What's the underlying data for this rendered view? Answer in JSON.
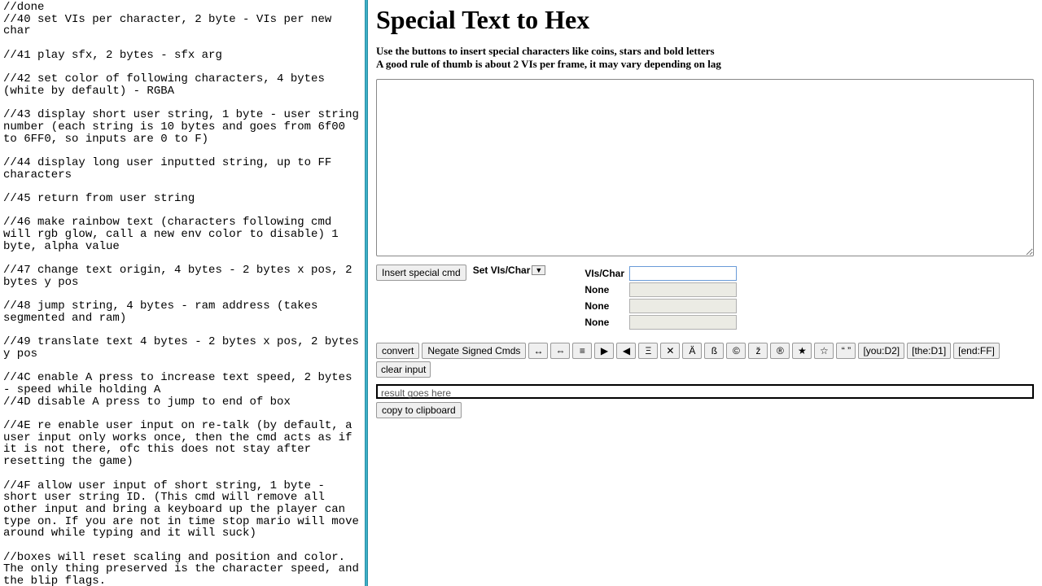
{
  "left": {
    "text": "//done\n//40 set VIs per character, 2 byte - VIs per new char\n\n//41 play sfx, 2 bytes - sfx arg\n\n//42 set color of following characters, 4 bytes (white by default) - RGBA\n\n//43 display short user string, 1 byte - user string number (each string is 10 bytes and goes from 6f00 to 6FF0, so inputs are 0 to F)\n\n//44 display long user inputted string, up to FF characters\n\n//45 return from user string\n\n//46 make rainbow text (characters following cmd will rgb glow, call a new env color to disable) 1 byte, alpha value\n\n//47 change text origin, 4 bytes - 2 bytes x pos, 2 bytes y pos\n\n//48 jump string, 4 bytes - ram address (takes segmented and ram)\n\n//49 translate text 4 bytes - 2 bytes x pos, 2 bytes y pos\n\n//4C enable A press to increase text speed, 2 bytes - speed while holding A\n//4D disable A press to jump to end of box\n\n//4E re enable user input on re-talk (by default, a user input only works once, then the cmd acts as if it is not there, ofc this does not stay after resetting the game)\n\n//4F allow user input of short string, 1 byte - short user string ID. (This cmd will remove all other input and bring a keyboard up the player can type on. If you are not in time stop mario will move around while typing and it will suck)\n\n//boxes will reset scaling and position and color. The only thing preserved is the character speed, and the blip flags."
  },
  "right": {
    "title": "Special Text to Hex",
    "subtitle1": "Use the buttons to insert special characters like coins, stars and bold letters",
    "subtitle2": "A good rule of thumb is about 2 VIs per frame, it may vary depending on lag",
    "insert_cmd": "Insert special cmd",
    "set_vis_label": "Set VIs/Char",
    "dropdown_caret": "▼",
    "vis_table": {
      "row1_label": "VIs/Char",
      "row2_label": "None",
      "row3_label": "None",
      "row4_label": "None"
    },
    "buttons": {
      "convert": "convert",
      "negate": "Negate Signed Cmds",
      "b1": "↔",
      "b2": "⇔",
      "b3": "≡",
      "b4": "▶",
      "b5": "◀",
      "b6": "Ξ",
      "b7": "✕",
      "b8": "Ä",
      "b9": "ß",
      "b10": "©",
      "b11": "ž",
      "b12": "®",
      "b13": "★",
      "b14": "☆",
      "b15": "“ ”",
      "b16": "[you:D2]",
      "b17": "[the:D1]",
      "b18": "[end:FF]",
      "b19": "clear input"
    },
    "result_placeholder": "result goes here",
    "copy": "copy to clipboard"
  }
}
